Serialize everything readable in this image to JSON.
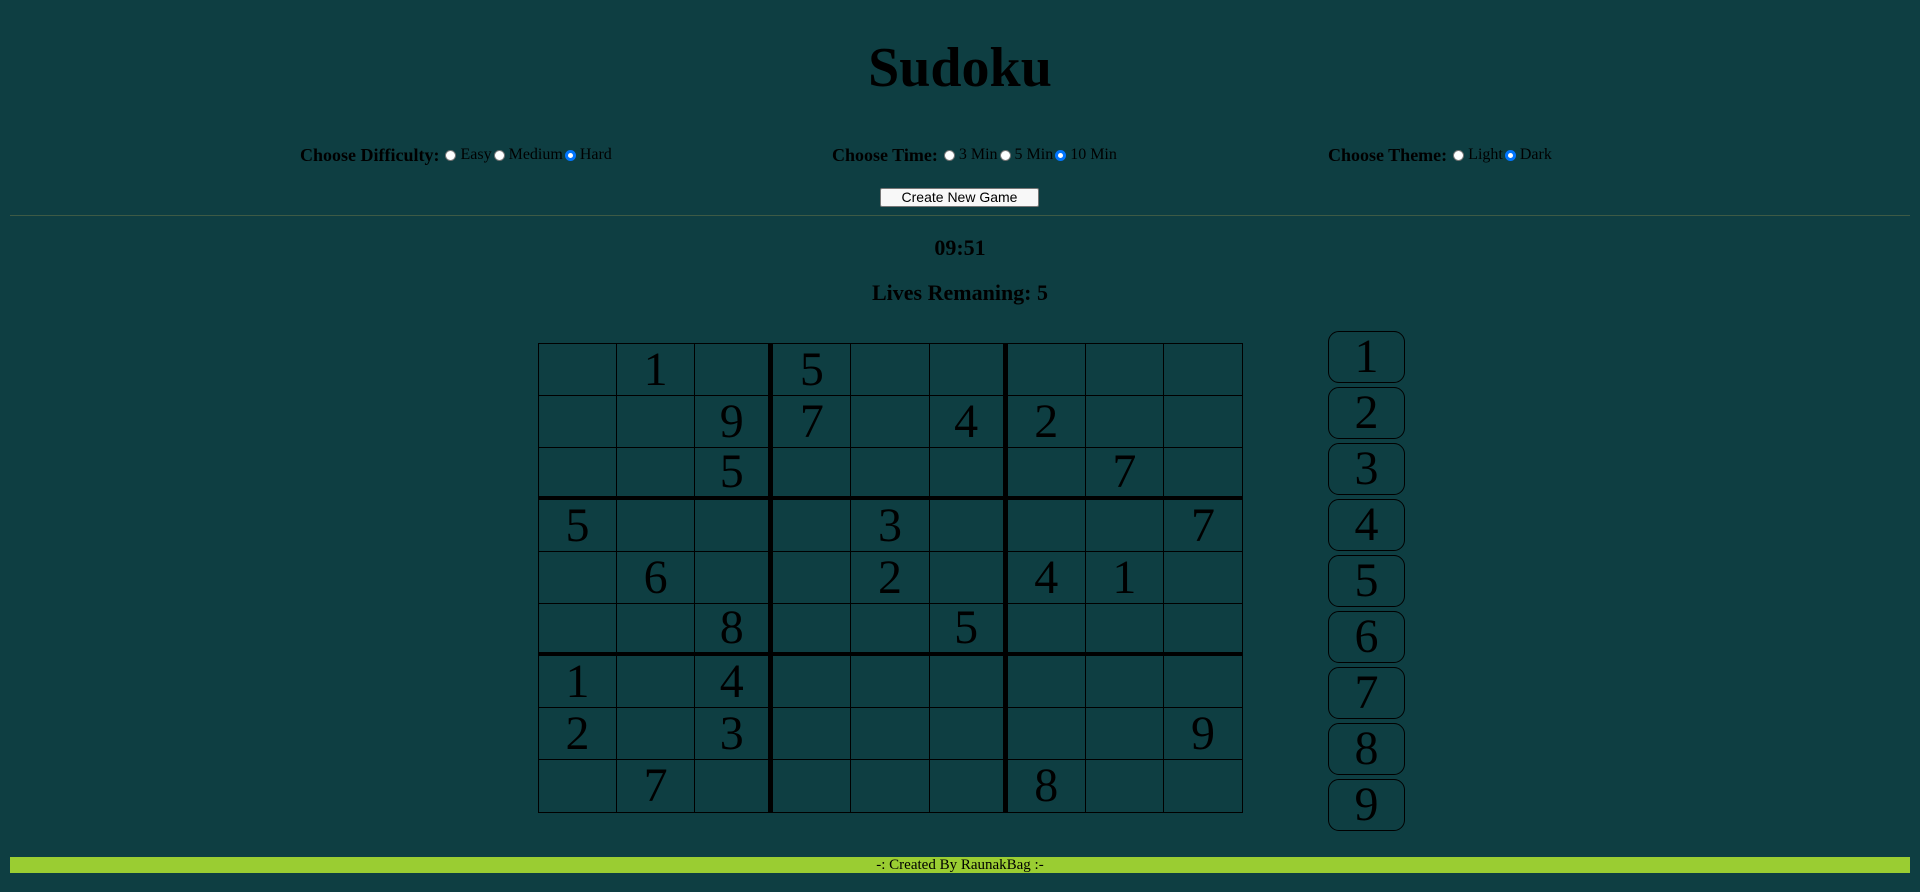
{
  "title": "Sudoku",
  "options": {
    "difficulty": {
      "label": "Choose Difficulty:",
      "choices": [
        "Easy",
        "Medium",
        "Hard"
      ],
      "selected": "Hard"
    },
    "time": {
      "label": "Choose Time:",
      "choices": [
        "3 Min",
        "5 Min",
        "10 Min"
      ],
      "selected": "10 Min"
    },
    "theme": {
      "label": "Choose Theme:",
      "choices": [
        "Light",
        "Dark"
      ],
      "selected": "Dark"
    }
  },
  "new_game_label": "Create New Game",
  "timer": "09:51",
  "lives_text": "Lives Remaning: 5",
  "board": [
    [
      "",
      "1",
      "",
      "5",
      "",
      "",
      "",
      "",
      ""
    ],
    [
      "",
      "",
      "9",
      "7",
      "",
      "4",
      "2",
      "",
      ""
    ],
    [
      "",
      "",
      "5",
      "",
      "",
      "",
      "",
      "7",
      ""
    ],
    [
      "5",
      "",
      "",
      "",
      "3",
      "",
      "",
      "",
      "7"
    ],
    [
      "",
      "6",
      "",
      "",
      "2",
      "",
      "4",
      "1",
      ""
    ],
    [
      "",
      "",
      "8",
      "",
      "",
      "5",
      "",
      "",
      ""
    ],
    [
      "1",
      "",
      "4",
      "",
      "",
      "",
      "",
      "",
      ""
    ],
    [
      "2",
      "",
      "3",
      "",
      "",
      "",
      "",
      "",
      "9"
    ],
    [
      "",
      "7",
      "",
      "",
      "",
      "",
      "8",
      "",
      ""
    ]
  ],
  "numpad": [
    "1",
    "2",
    "3",
    "4",
    "5",
    "6",
    "7",
    "8",
    "9"
  ],
  "footer": "-: Created By RaunakBag :-",
  "colors": {
    "background": "#0e3e42",
    "footer": "#9acd32",
    "radio_checked": "#0075ff"
  }
}
